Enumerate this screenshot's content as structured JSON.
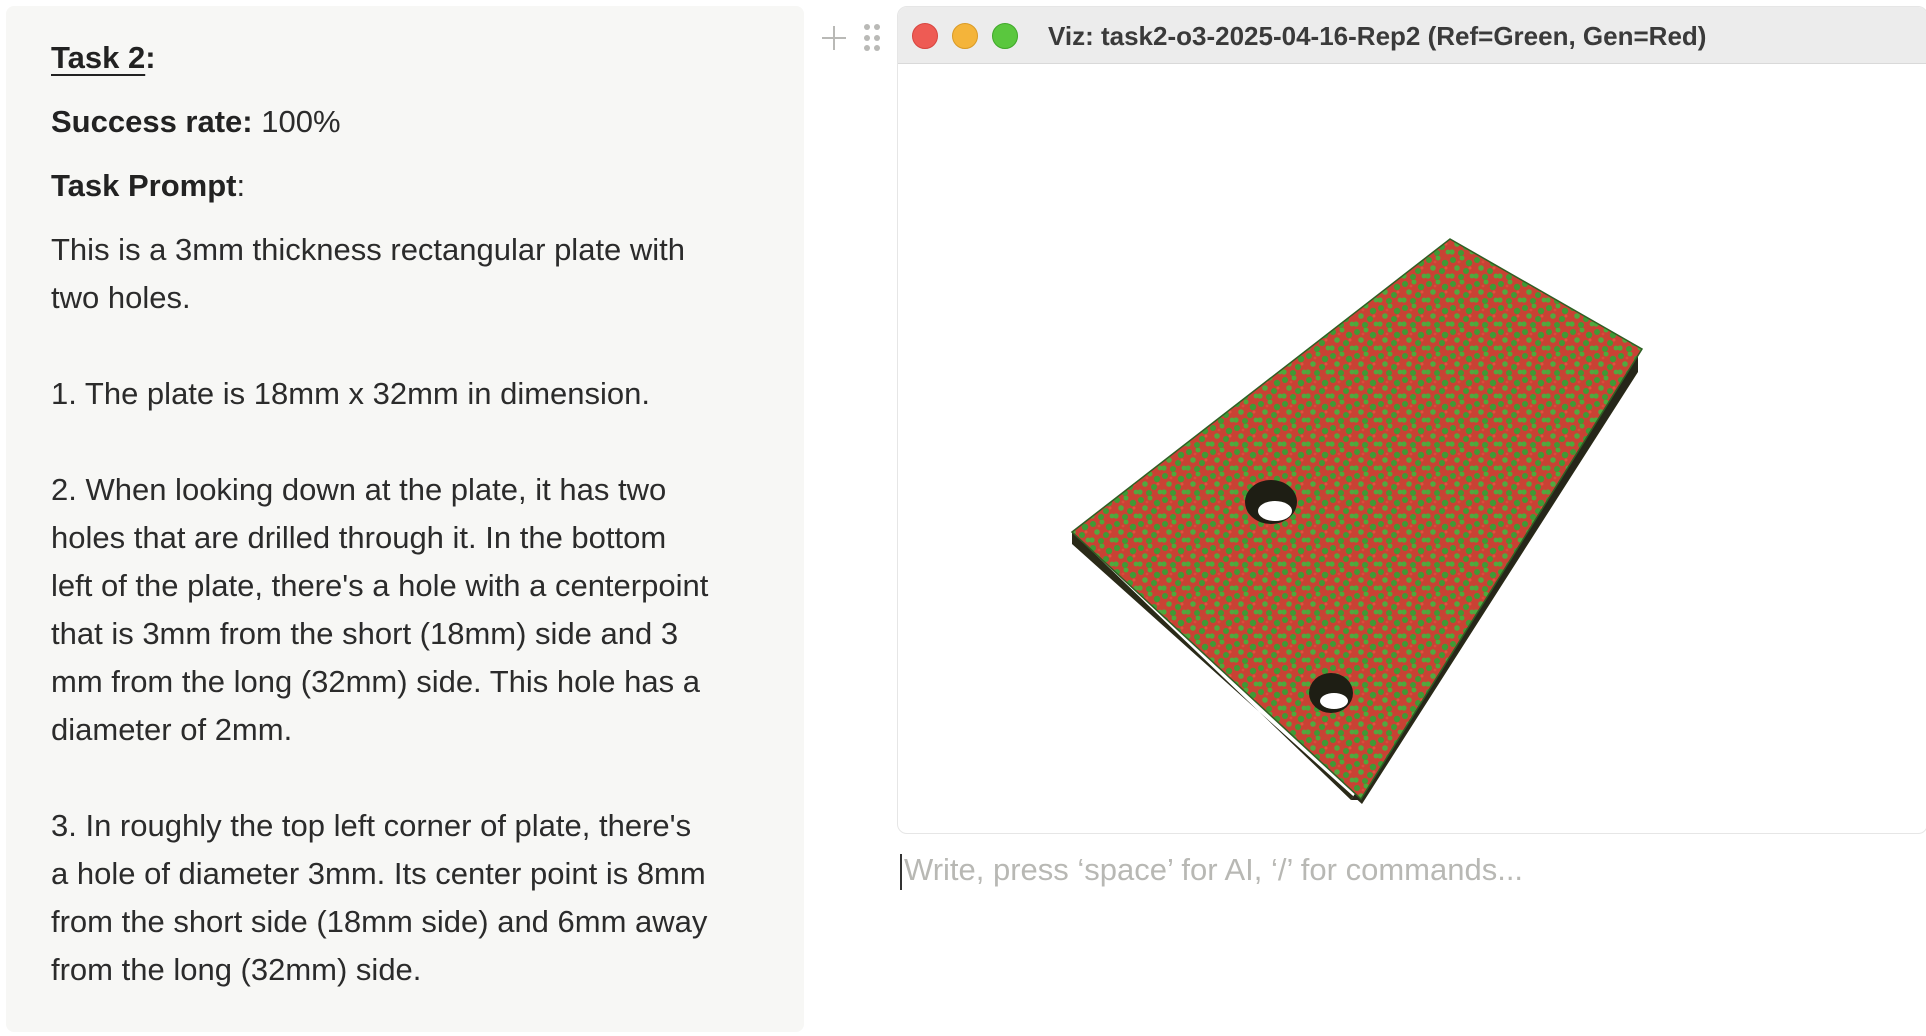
{
  "callout": {
    "heading_label": "Task 2",
    "heading_suffix": ":",
    "success_label": "Success rate:",
    "success_value": "100%",
    "prompt_label": "Task Prompt",
    "prompt_suffix": ":",
    "paragraphs": [
      [
        "This is a 3mm thickness rectangular plate with",
        "two holes."
      ],
      [
        "1. The plate is 18mm x 32mm in dimension."
      ],
      [
        "2. When looking down at the plate, it has two",
        "holes that are drilled through it. In the bottom",
        "left of the plate, there's a hole with a centerpoint",
        "that is 3mm from the short (18mm) side and 3",
        "mm from the long (32mm) side. This hole has a",
        "diameter of 2mm."
      ],
      [
        "3. In roughly the top left corner of plate, there's",
        "a hole of diameter 3mm. Its center point is 8mm",
        "from the short side (18mm side) and 6mm away",
        "from the long (32mm) side."
      ]
    ]
  },
  "block_tools": {
    "add_icon": "plus-icon",
    "drag_icon": "drag-handle-icon"
  },
  "viz_window": {
    "title": "Viz: task2-o3-2025-04-16-Rep2 (Ref=Green, Gen=Red)",
    "colors": {
      "reference": "#3f9a35",
      "generated": "#d23a3a",
      "edge": "#2a2a18"
    }
  },
  "editor": {
    "placeholder": "Write, press ‘space’ for AI, ‘/’ for commands..."
  }
}
